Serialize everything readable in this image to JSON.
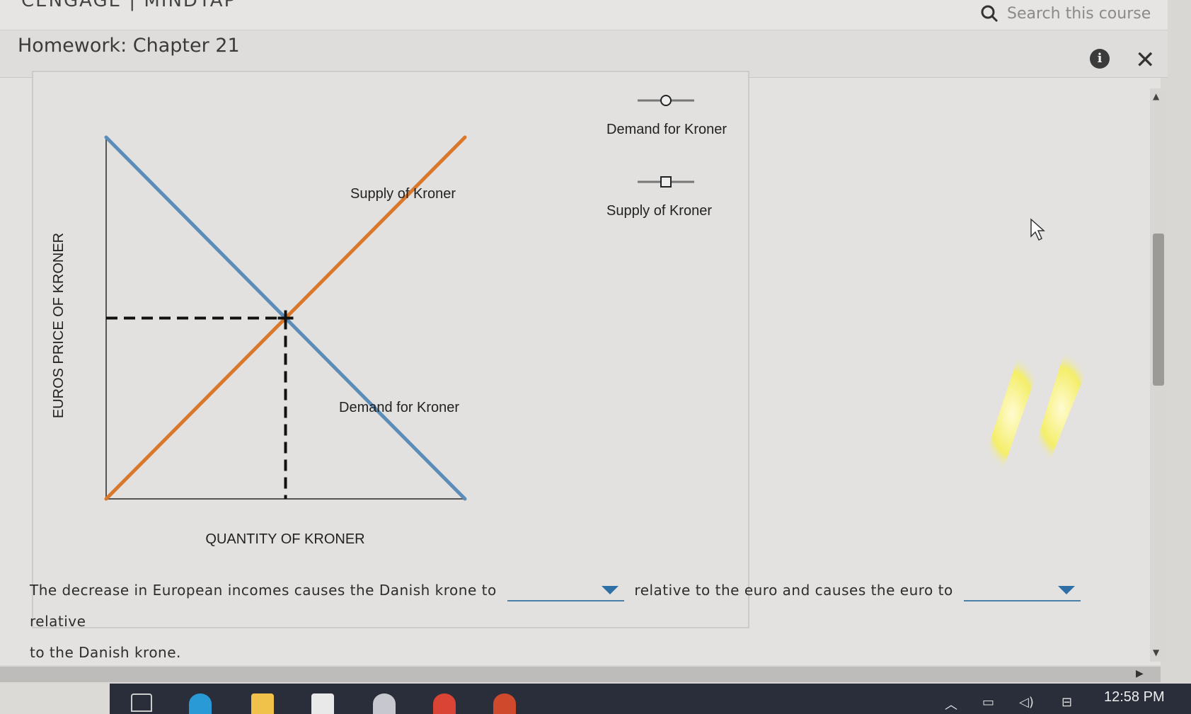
{
  "header": {
    "brand": "CENGAGE | MINDTAP",
    "search_placeholder": "Search this course"
  },
  "titlebar": {
    "title": "Homework: Chapter 21",
    "info_label": "i",
    "close_label": "✕"
  },
  "chart_data": {
    "type": "line",
    "xlabel": "QUANTITY OF KRONER",
    "ylabel": "EUROS PRICE OF KRONER",
    "series": [
      {
        "name": "Supply of Kroner",
        "color": "#d9772b",
        "marker": "square",
        "points": [
          [
            0,
            0
          ],
          [
            1,
            1
          ]
        ]
      },
      {
        "name": "Demand for Kroner",
        "color": "#5b8db8",
        "marker": "circle",
        "points": [
          [
            0,
            1
          ],
          [
            1,
            0
          ]
        ]
      }
    ],
    "equilibrium": {
      "x": 0.5,
      "y": 0.5
    },
    "legend": [
      "Demand for Kroner",
      "Supply of Kroner"
    ],
    "legend_position": "right"
  },
  "question": {
    "part1": "The decrease in European incomes causes the Danish krone to",
    "part2": "relative to the euro and causes the euro to",
    "part3": "relative",
    "part4": "to the Danish krone.",
    "dropdown1_value": "",
    "dropdown2_value": ""
  },
  "taskbar": {
    "time": "12:58 PM"
  }
}
